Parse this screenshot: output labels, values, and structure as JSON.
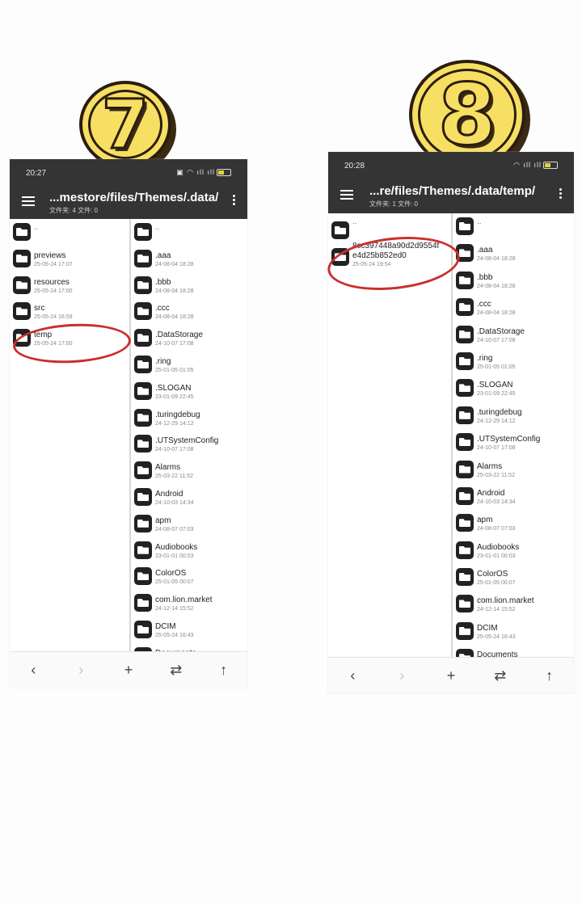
{
  "badges": {
    "step7": "7",
    "step8": "8"
  },
  "phone7": {
    "status": {
      "time": "20:27",
      "icons": "▣ ◠ ıll ıll"
    },
    "title": "...mestore/files/Themes/.data/",
    "subtitle": "文件夹: 4  文件: 0",
    "left": [
      {
        "name": "..",
        "date": ""
      },
      {
        "name": "previews",
        "date": "25-05-24 17:07"
      },
      {
        "name": "resources",
        "date": "25-05-24 17:00"
      },
      {
        "name": "src",
        "date": "25-05-24 16:59"
      },
      {
        "name": "temp",
        "date": "25-05-24 17:00"
      }
    ],
    "right": [
      {
        "name": "..",
        "date": ""
      },
      {
        "name": ".aaa",
        "date": "24-08-04 18:28"
      },
      {
        "name": ".bbb",
        "date": "24-08-04 18:28"
      },
      {
        "name": ".ccc",
        "date": "24-08-04 18:28"
      },
      {
        "name": ".DataStorage",
        "date": "24-10-07 17:08"
      },
      {
        "name": ".ring",
        "date": "25-01-05 01:05"
      },
      {
        "name": ".SLOGAN",
        "date": "23-01-09 22:45"
      },
      {
        "name": ".turingdebug",
        "date": "24-12-29 14:12"
      },
      {
        "name": ".UTSystemConfig",
        "date": "24-10-07 17:08"
      },
      {
        "name": "Alarms",
        "date": "25-03-22 11:52"
      },
      {
        "name": "Android",
        "date": "24-10-03 14:34"
      },
      {
        "name": "apm",
        "date": "24-08-07 07:03"
      },
      {
        "name": "Audiobooks",
        "date": "23-01-01 00:03"
      },
      {
        "name": "ColorOS",
        "date": "25-01-05 00:07"
      },
      {
        "name": "com.lion.market",
        "date": "24-12-14 15:52"
      },
      {
        "name": "DCIM",
        "date": "25-05-24 16:43"
      },
      {
        "name": "Documents",
        "date": ""
      }
    ],
    "toolbar": {
      "back": "‹",
      "forward": "›",
      "add": "+",
      "swap": "⇄",
      "up": "↑"
    }
  },
  "phone8": {
    "status": {
      "time": "20:28",
      "icons": "◠ ıll ıll"
    },
    "title": "...re/files/Themes/.data/temp/",
    "subtitle": "文件夹: 1  文件: 0",
    "left": [
      {
        "name": "..",
        "date": ""
      },
      {
        "name": "8cc397448a90d2d9554fe4d25b852ed0",
        "date": "25-05-24 19:54"
      }
    ],
    "right": [
      {
        "name": "..",
        "date": ""
      },
      {
        "name": ".aaa",
        "date": "24-08-04 18:28"
      },
      {
        "name": ".bbb",
        "date": "24-08-04 18:28"
      },
      {
        "name": ".ccc",
        "date": "24-08-04 18:28"
      },
      {
        "name": ".DataStorage",
        "date": "24-10-07 17:08"
      },
      {
        "name": ".ring",
        "date": "25-01-05 01:05"
      },
      {
        "name": ".SLOGAN",
        "date": "23-01-09 22:45"
      },
      {
        "name": ".turingdebug",
        "date": "24-12-29 14:12"
      },
      {
        "name": ".UTSystemConfig",
        "date": "24-10-07 17:08"
      },
      {
        "name": "Alarms",
        "date": "25-03-22 11:52"
      },
      {
        "name": "Android",
        "date": "24-10-03 14:34"
      },
      {
        "name": "apm",
        "date": "24-08-07 07:03"
      },
      {
        "name": "Audiobooks",
        "date": "23-01-01 00:03"
      },
      {
        "name": "ColorOS",
        "date": "25-01-05 00:07"
      },
      {
        "name": "com.lion.market",
        "date": "24-12-14 15:52"
      },
      {
        "name": "DCIM",
        "date": "25-05-24 16:43"
      },
      {
        "name": "Documents",
        "date": ""
      }
    ],
    "toolbar": {
      "back": "‹",
      "forward": "›",
      "add": "+",
      "swap": "⇄",
      "up": "↑"
    }
  }
}
